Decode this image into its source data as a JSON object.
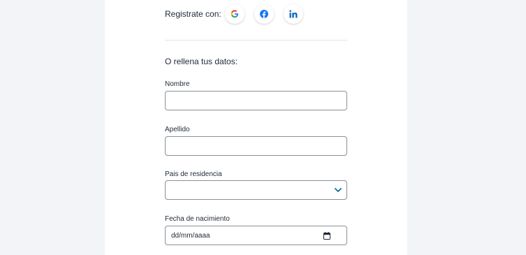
{
  "social": {
    "label": "Registrate con:",
    "buttons": [
      {
        "name": "google",
        "icon": "google-icon"
      },
      {
        "name": "facebook",
        "icon": "facebook-icon"
      },
      {
        "name": "linkedin",
        "icon": "linkedin-icon"
      }
    ]
  },
  "form": {
    "subtitle": "O rellena tus datos:",
    "nombre": {
      "label": "Nombre",
      "value": "",
      "placeholder": ""
    },
    "apellido": {
      "label": "Apellido",
      "value": "",
      "placeholder": ""
    },
    "pais": {
      "label": "Pais de residencia",
      "selected": ""
    },
    "fecha": {
      "label": "Fecha de nacimiento",
      "placeholder": "dd/mm/aaaa"
    }
  },
  "colors": {
    "page_bg": "#f3f4f7",
    "card_bg": "#ffffff",
    "border": "#8a9099",
    "accent": "#0f6f8e",
    "google_blue": "#4285F4",
    "google_red": "#EA4335",
    "google_yellow": "#FBBC05",
    "google_green": "#34A853",
    "facebook": "#1877F2",
    "linkedin": "#0A66C2"
  }
}
